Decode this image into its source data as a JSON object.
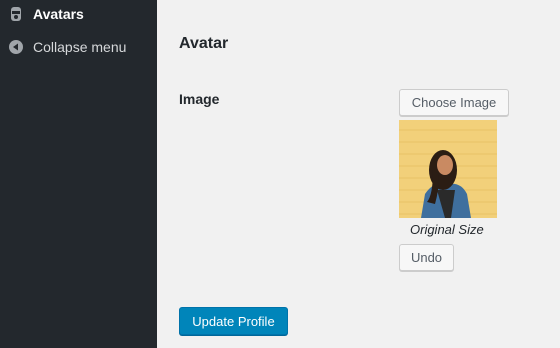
{
  "sidebar": {
    "items": [
      {
        "label": "Avatars",
        "icon": "avatar-icon"
      },
      {
        "label": "Collapse menu",
        "icon": "collapse-arrow-icon"
      }
    ]
  },
  "main": {
    "section_title": "Avatar",
    "field_label": "Image",
    "choose_button": "Choose Image",
    "image_caption": "Original Size",
    "undo_button": "Undo",
    "submit_button": "Update Profile"
  },
  "colors": {
    "sidebar_bg": "#23282d",
    "content_bg": "#f1f1f1",
    "primary_button": "#0085ba",
    "photo_wall": "#f2d07a"
  }
}
